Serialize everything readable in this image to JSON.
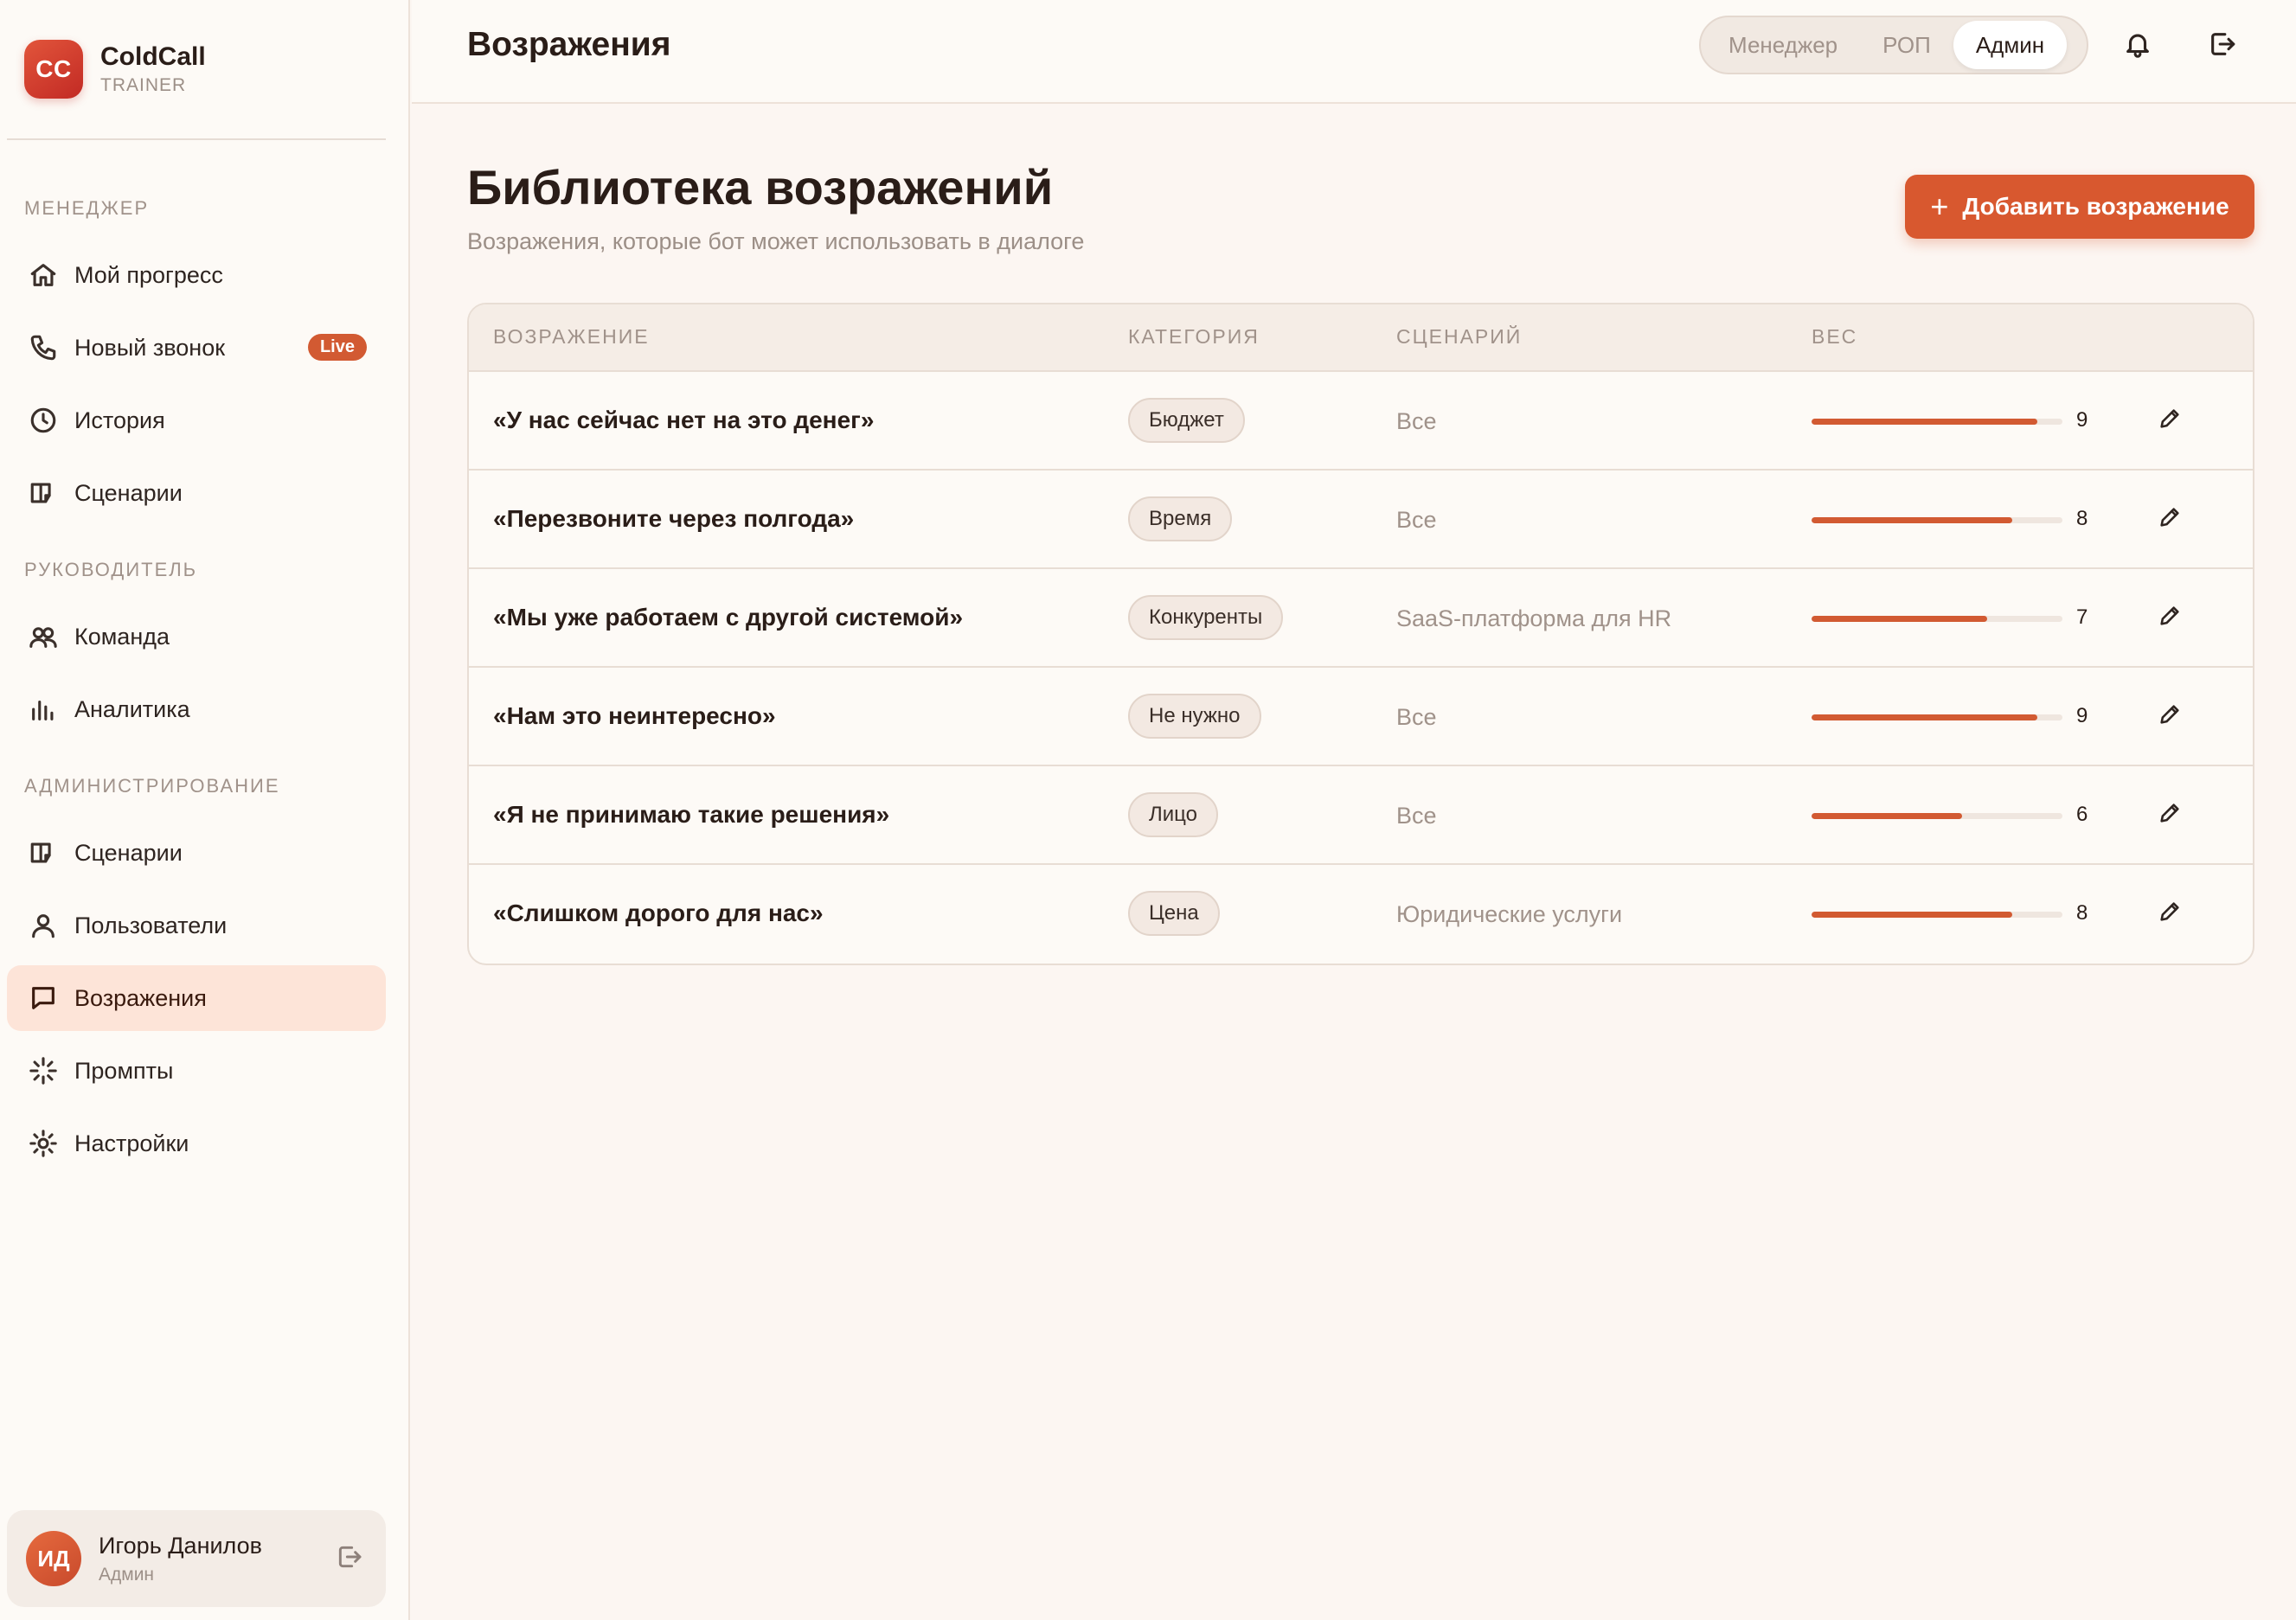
{
  "brand": {
    "logo": "CC",
    "name": "ColdCall",
    "sub": "TRAINER"
  },
  "sidebar": {
    "sections": [
      {
        "title": "МЕНЕДЖЕР",
        "items": [
          {
            "label": "Мой прогресс",
            "icon": "home-icon"
          },
          {
            "label": "Новый звонок",
            "icon": "phone-icon",
            "badge": "Live"
          },
          {
            "label": "История",
            "icon": "clock-icon"
          },
          {
            "label": "Сценарии",
            "icon": "book-icon"
          }
        ]
      },
      {
        "title": "РУКОВОДИТЕЛЬ",
        "items": [
          {
            "label": "Команда",
            "icon": "users-icon"
          },
          {
            "label": "Аналитика",
            "icon": "bar-chart-icon"
          }
        ]
      },
      {
        "title": "АДМИНИСТРИРОВАНИЕ",
        "items": [
          {
            "label": "Сценарии",
            "icon": "book-icon"
          },
          {
            "label": "Пользователи",
            "icon": "user-icon"
          },
          {
            "label": "Возражения",
            "icon": "message-icon",
            "active": true
          },
          {
            "label": "Промпты",
            "icon": "sparkle-icon"
          },
          {
            "label": "Настройки",
            "icon": "sun-gear-icon"
          }
        ]
      }
    ]
  },
  "user": {
    "initials": "ИД",
    "name": "Игорь Данилов",
    "role": "Админ"
  },
  "topbar": {
    "title": "Возражения",
    "roles": [
      {
        "label": "Менеджер",
        "active": false
      },
      {
        "label": "РОП",
        "active": false
      },
      {
        "label": "Админ",
        "active": true
      }
    ]
  },
  "page": {
    "title": "Библиотека возражений",
    "subtitle": "Возражения, которые бот может использовать в диалоге",
    "add_button": "Добавить возражение"
  },
  "table": {
    "headers": {
      "objection": "ВОЗРАЖЕНИЕ",
      "category": "КАТЕГОРИЯ",
      "scenario": "СЦЕНАРИЙ",
      "weight": "ВЕС"
    },
    "max_weight": 10,
    "rows": [
      {
        "objection": "«У нас сейчас нет на это денег»",
        "category": "Бюджет",
        "scenario": "Все",
        "weight": 9
      },
      {
        "objection": "«Перезвоните через полгода»",
        "category": "Время",
        "scenario": "Все",
        "weight": 8
      },
      {
        "objection": "«Мы уже работаем с другой системой»",
        "category": "Конкуренты",
        "scenario": "SaaS-платформа для HR",
        "weight": 7
      },
      {
        "objection": "«Нам это неинтересно»",
        "category": "Не нужно",
        "scenario": "Все",
        "weight": 9
      },
      {
        "objection": "«Я не принимаю такие решения»",
        "category": "Лицо",
        "scenario": "Все",
        "weight": 6
      },
      {
        "objection": "«Слишком дорого для нас»",
        "category": "Цена",
        "scenario": "Юридические услуги",
        "weight": 8
      }
    ]
  },
  "colors": {
    "accent": "#d8582f",
    "active_nav_bg": "#fde4d8",
    "background": "#fcf6f2"
  }
}
